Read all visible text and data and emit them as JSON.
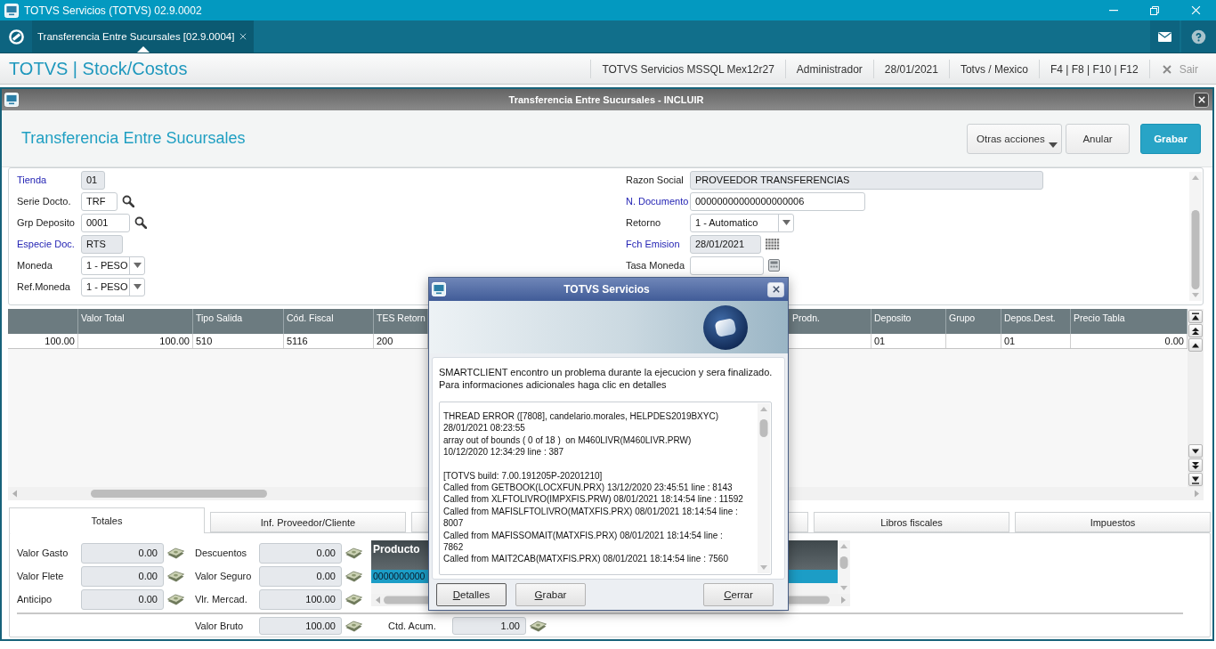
{
  "window": {
    "title": "TOTVS Servicios (TOTVS) 02.9.0002"
  },
  "app_tabs": [
    {
      "label": "Transferencia Entre Sucursales [02.9.0004]",
      "selected": true
    }
  ],
  "header": {
    "module": "TOTVS | Stock/Costos",
    "info": [
      "TOTVS Servicios MSSQL Mex12r27",
      "Administrador",
      "28/01/2021",
      "Totvs / Mexico",
      "F4 | F8 | F10 | F12"
    ],
    "exit": "Sair"
  },
  "child_window": {
    "title": "Transferencia Entre Sucursales - INCLUIR",
    "heading": "Transferencia Entre Sucursales",
    "actions": [
      {
        "label": "Otras acciones",
        "kind": "menu"
      },
      {
        "label": "Anular",
        "kind": "secondary"
      },
      {
        "label": "Grabar",
        "kind": "primary"
      }
    ]
  },
  "form": {
    "left": [
      {
        "label": "Tienda",
        "required": true,
        "kind": "readonly",
        "value": "01"
      },
      {
        "label": "Serie Docto.",
        "required": false,
        "kind": "lookup",
        "value": "TRF"
      },
      {
        "label": "Grp Deposito",
        "required": false,
        "kind": "lookup",
        "value": "0001"
      },
      {
        "label": "Especie Doc.",
        "required": true,
        "kind": "readonly",
        "value": "RTS"
      },
      {
        "label": "Moneda",
        "required": false,
        "kind": "select",
        "value": "1 - PESO"
      },
      {
        "label": "Ref.Moneda",
        "required": false,
        "kind": "select",
        "value": "1 - PESO"
      }
    ],
    "right": [
      {
        "label": "Razon Social",
        "required": false,
        "kind": "readonly",
        "value": "PROVEEDOR TRANSFERENCIAS"
      },
      {
        "label": "N. Documento",
        "required": true,
        "kind": "text",
        "value": "00000000000000000006"
      },
      {
        "label": "Retorno",
        "required": false,
        "kind": "select",
        "value": "1 - Automatico"
      },
      {
        "label": "Fch Emision",
        "required": true,
        "kind": "date",
        "value": "28/01/2021"
      },
      {
        "label": "Tasa Moneda",
        "required": false,
        "kind": "calc"
      }
    ]
  },
  "grid": {
    "columns": [
      {
        "numeric": true
      },
      {
        "label": "Valor Total",
        "numeric": true
      },
      {
        "label": "Tipo Salida",
        "numeric": false
      },
      {
        "label": "Cód. Fiscal",
        "numeric": false
      },
      {
        "label": "TES Retorn",
        "numeric": false
      },
      {
        "label": "Prodn."
      },
      {
        "label": "Deposito",
        "numeric": false
      },
      {
        "label": "Grupo"
      },
      {
        "label": "Depos.Dest.",
        "numeric": false
      },
      {
        "label": "Precio Tabla",
        "numeric": true
      }
    ],
    "rows": [
      [
        "100.00",
        "100.00",
        "510",
        "5116",
        "200",
        null,
        "01",
        null,
        "01",
        "0.00"
      ]
    ]
  },
  "bottom_tabs": [
    {
      "label": "Totales",
      "selected": true
    },
    {
      "label": "Inf. Proveedor/Cliente",
      "selected": false
    },
    {
      "selected": false
    },
    {
      "selected": false
    },
    {
      "label": "Libros fiscales",
      "selected": false
    },
    {
      "label": "Impuestos",
      "selected": false
    }
  ],
  "totals": {
    "column_1": [
      {
        "label": "Valor Gasto",
        "value": "0.00"
      },
      {
        "label": "Valor Flete",
        "value": "0.00"
      },
      {
        "label": "Anticipo",
        "value": "0.00"
      }
    ],
    "column_2": [
      {
        "label": "Descuentos",
        "value": "0.00"
      },
      {
        "label": "Valor Seguro",
        "value": "0.00"
      },
      {
        "label": "Vlr. Mercad.",
        "value": "100.00"
      }
    ],
    "products": {
      "heading": "Producto",
      "rows": [
        {
          "value": "0000000000",
          "selected": true
        }
      ]
    },
    "footer": [
      {
        "label": "Valor Bruto",
        "value": "100.00"
      },
      {
        "label": "Ctd. Acum.",
        "value": "1.00"
      }
    ]
  },
  "dialog": {
    "title": "TOTVS Servicios",
    "message": [
      "SMARTCLIENT encontro un problema durante la ejecucion y sera finalizado.",
      "Para informaciones adicionales haga clic en detalles"
    ],
    "log": [
      [
        "THREAD ERROR ([7808], candelario.morales, HELPDES2019BXYC)",
        "28/01/2021 08:23:55",
        "array out of bounds ( 0 of 18 )  on M460LIVR(M460LIVR.PRW)",
        "10/12/2020 12:34:29 line : 387"
      ],
      [
        "[TOTVS build: 7.00.191205P-20201210]",
        "Called from GETBOOK(LOCXFUN.PRX) 13/12/2020 23:45:51 line : 8143",
        "Called from XLFTOLIVRO(IMPXFIS.PRW) 08/01/2021 18:14:54 line : 11592",
        "Called from MAFISLFTOLIVRO(MATXFIS.PRX) 08/01/2021 18:14:54 line :",
        "8007",
        "Called from MAFISSOMAIT(MATXFIS.PRX) 08/01/2021 18:14:54 line :",
        "7862",
        "Called from MAIT2CAB(MATXFIS.PRX) 08/01/2021 18:14:54 line : 7560"
      ]
    ],
    "buttons": [
      {
        "label": "Detalles",
        "focused": true
      },
      {
        "label": "Grabar",
        "focused": false
      },
      {
        "label": "Cerrar",
        "focused": false
      }
    ]
  }
}
